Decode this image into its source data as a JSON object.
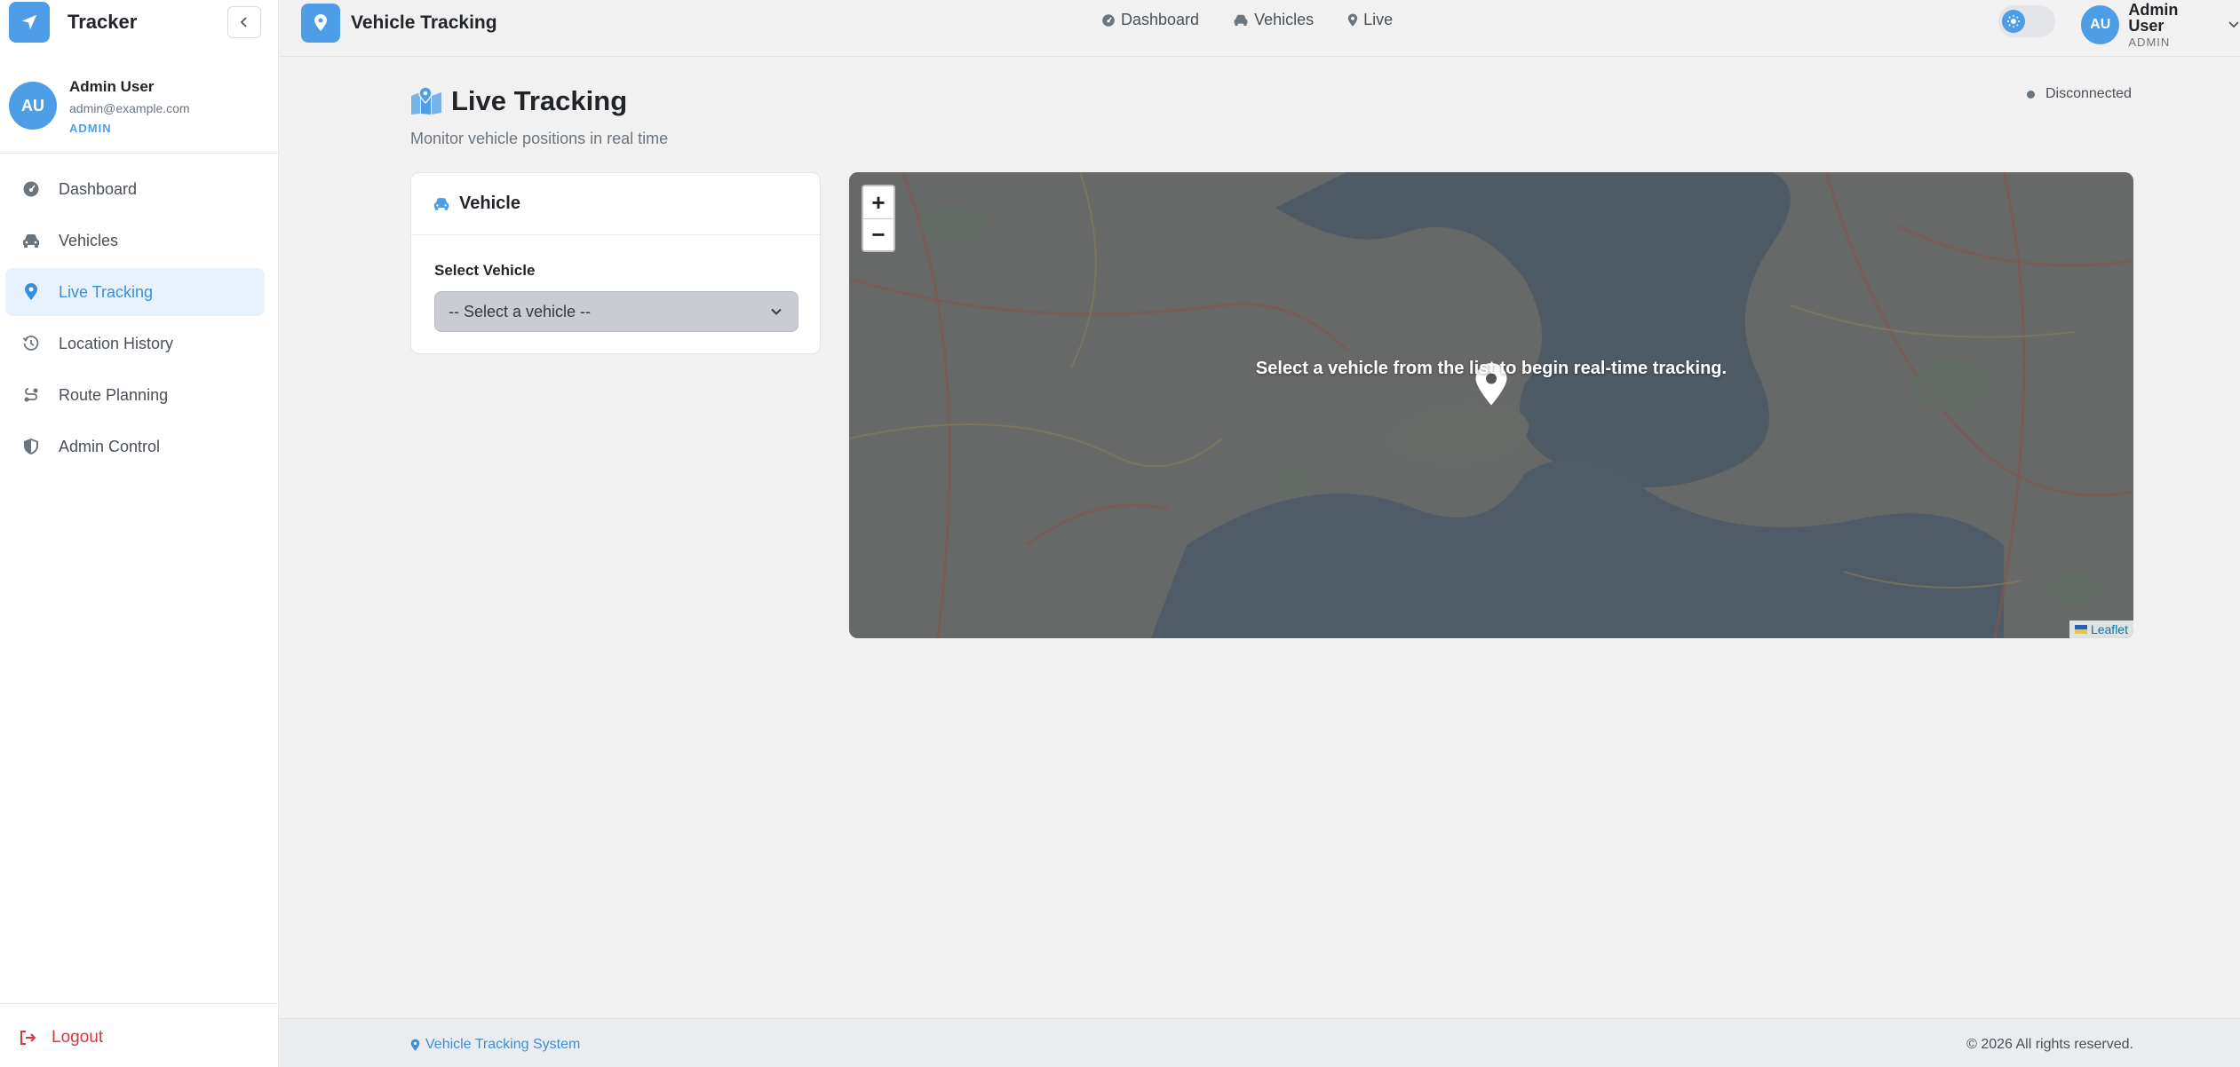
{
  "sidebar": {
    "brand": "Tracker",
    "user": {
      "initials": "AU",
      "name": "Admin User",
      "email": "admin@example.com",
      "role": "ADMIN"
    },
    "items": [
      {
        "label": "Dashboard",
        "icon": "dashboard-gauge-icon"
      },
      {
        "label": "Vehicles",
        "icon": "car-icon"
      },
      {
        "label": "Live Tracking",
        "icon": "map-pin-icon",
        "active": true
      },
      {
        "label": "Location History",
        "icon": "history-icon"
      },
      {
        "label": "Route Planning",
        "icon": "route-icon"
      },
      {
        "label": "Admin Control",
        "icon": "shield-icon"
      }
    ],
    "logout": "Logout"
  },
  "topbar": {
    "title": "Vehicle Tracking",
    "nav": [
      {
        "label": "Dashboard",
        "icon": "dashboard-gauge-icon"
      },
      {
        "label": "Vehicles",
        "icon": "car-icon"
      },
      {
        "label": "Live",
        "icon": "map-pin-icon"
      }
    ],
    "user": {
      "initials": "AU",
      "name": "Admin User",
      "role": "ADMIN"
    }
  },
  "page": {
    "title": "Live Tracking",
    "subtitle": "Monitor vehicle positions in real time",
    "status": "Disconnected"
  },
  "vehicle_card": {
    "title": "Vehicle",
    "select_label": "Select Vehicle",
    "select_value": "-- Select a vehicle --"
  },
  "map": {
    "zoom_in": "+",
    "zoom_out": "−",
    "message": "Select a vehicle from the list to begin real-time tracking.",
    "attribution": "Leaflet"
  },
  "footer": {
    "left": "Vehicle Tracking System",
    "right": "© 2026 All rights reserved."
  },
  "colors": {
    "accent": "#4d9ee6",
    "danger": "#d9363e",
    "background": "#f1f1f1"
  }
}
